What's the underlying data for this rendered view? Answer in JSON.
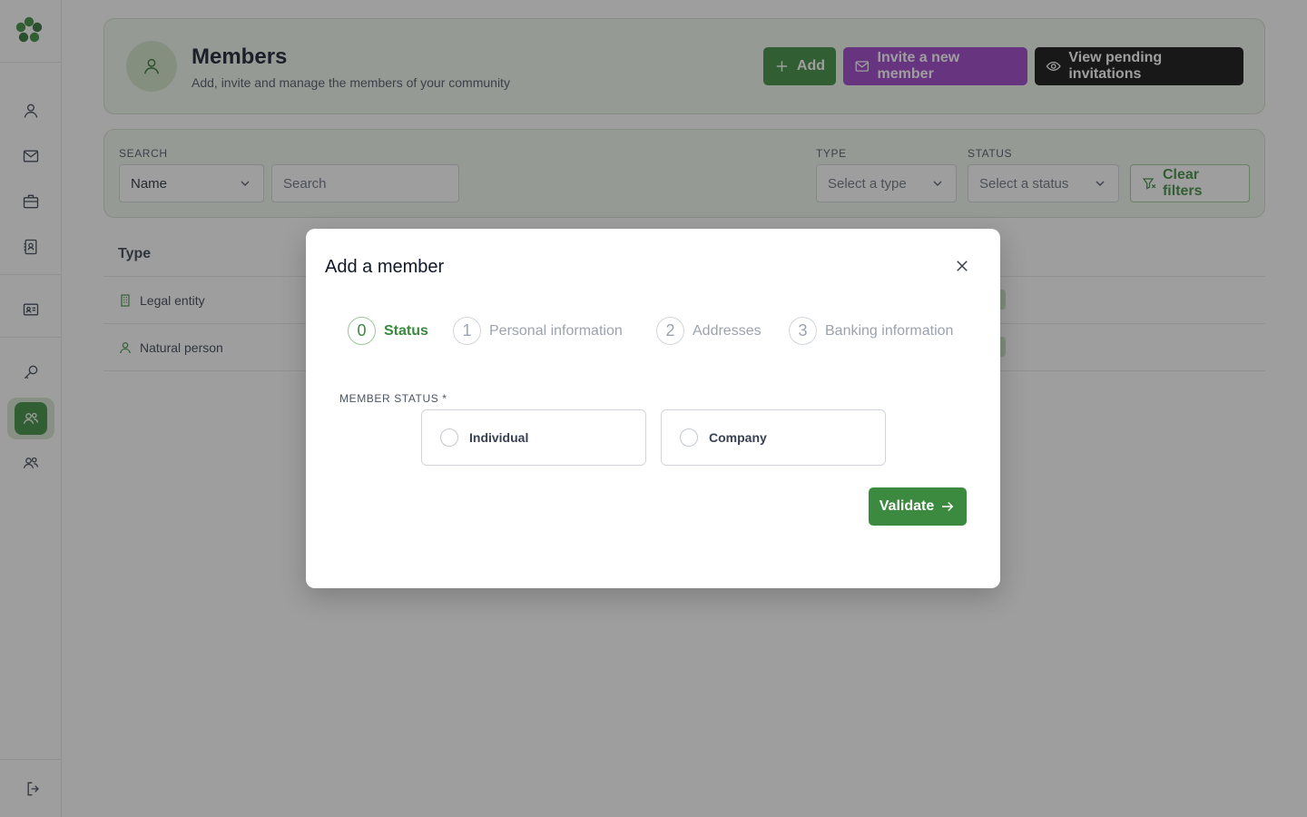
{
  "colors": {
    "accent": "#3b8a3f",
    "invite": "#9b3fc9",
    "dark": "#0b0b0b"
  },
  "sidebar": {
    "icons": [
      "logo-icon",
      "user-icon",
      "mail-icon",
      "briefcase-icon",
      "contact-book-icon",
      "id-card-icon",
      "search-key-icon",
      "members-icon",
      "community-icon",
      "logout-icon"
    ]
  },
  "header": {
    "title": "Members",
    "subtitle": "Add, invite and manage the members of your community",
    "add_label": "Add",
    "invite_label": "Invite a new member",
    "pending_label": "View pending invitations"
  },
  "filters": {
    "search_label": "SEARCH",
    "search_field_value": "Name",
    "search_placeholder": "Search",
    "type_label": "TYPE",
    "type_placeholder": "Select a type",
    "status_label": "STATUS",
    "status_placeholder": "Select a status",
    "clear_label": "Clear filters"
  },
  "table": {
    "header_type": "Type",
    "rows": [
      {
        "type": "Legal entity"
      },
      {
        "type": "Natural person"
      }
    ]
  },
  "modal": {
    "title": "Add a member",
    "steps": [
      {
        "num": "0",
        "label": "Status"
      },
      {
        "num": "1",
        "label": "Personal information"
      },
      {
        "num": "2",
        "label": "Addresses"
      },
      {
        "num": "3",
        "label": "Banking information"
      }
    ],
    "member_status_label": "MEMBER STATUS *",
    "options": [
      "Individual",
      "Company"
    ],
    "validate_label": "Validate"
  }
}
